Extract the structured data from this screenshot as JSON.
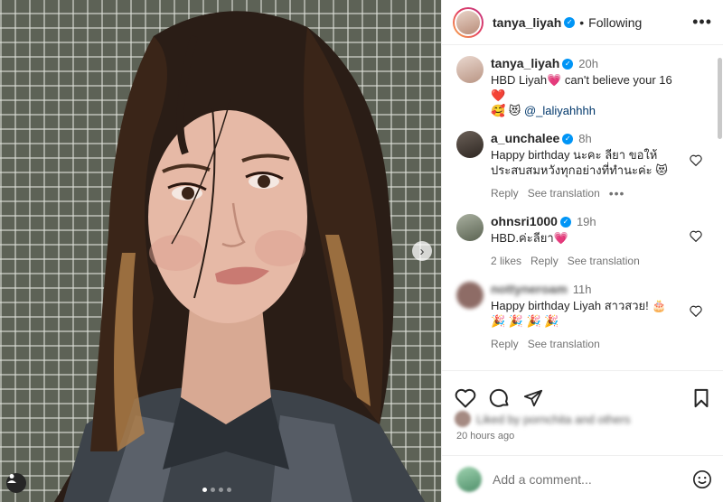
{
  "post": {
    "author": "tanya_liyah",
    "follow_sep": "•",
    "follow_state": "Following",
    "more_icon": "more-horizontal-icon"
  },
  "media": {
    "carousel_dots": 4,
    "active_dot": 0
  },
  "comments": [
    {
      "user": "tanya_liyah",
      "verified": true,
      "time": "20h",
      "text": "HBD Liyah💗 can't believe your 16❤️",
      "text2": "🥰 😻",
      "mention": "@_laliyahhhh",
      "meta": []
    },
    {
      "user": "a_unchalee",
      "verified": true,
      "time": "8h",
      "text": "Happy birthday นะคะ ลียา ขอให้ประสบสมหวังทุกอย่างที่ทำนะค่ะ 😻",
      "meta": [
        "Reply",
        "See translation"
      ],
      "more": "•••"
    },
    {
      "user": "ohnsri1000",
      "verified": true,
      "time": "19h",
      "text": "HBD.ค่ะลียา💗",
      "meta": [
        "2 likes",
        "Reply",
        "See translation"
      ]
    },
    {
      "user": "nottyneroam",
      "verified": false,
      "time": "11h",
      "text": "Happy birthday Liyah สาวสวย! 🎂",
      "text2": "🎉 🎉 🎉 🎉",
      "meta": [
        "Reply",
        "See translation"
      ]
    }
  ],
  "likes": {
    "text": "Liked by pornchita and others"
  },
  "time_ago": "20 hours ago",
  "add_comment": {
    "placeholder": "Add a comment..."
  },
  "colors": {
    "verified": "#0095f6",
    "mention": "#00376b",
    "secondary_text": "#737373"
  }
}
